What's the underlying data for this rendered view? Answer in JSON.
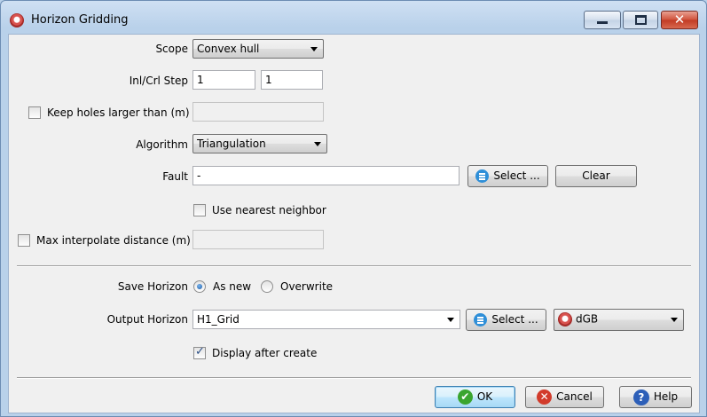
{
  "window": {
    "title": "Horizon Gridding",
    "minimize_glyph": "",
    "maximize_glyph": "",
    "close_glyph": "✕"
  },
  "scope": {
    "label": "Scope",
    "value": "Convex hull"
  },
  "step": {
    "label": "Inl/Crl Step",
    "inline": "1",
    "crossline": "1"
  },
  "keep_holes": {
    "label": "Keep holes larger than (m)",
    "checked": false,
    "value": ""
  },
  "algorithm": {
    "label": "Algorithm",
    "value": "Triangulation"
  },
  "fault": {
    "label": "Fault",
    "value": "-",
    "select_label": "Select ...",
    "clear_label": "Clear"
  },
  "nearest_neighbor": {
    "label": "Use nearest neighbor",
    "checked": false
  },
  "max_interp": {
    "label": "Max interpolate distance (m)",
    "checked": false,
    "value": ""
  },
  "save_horizon": {
    "label": "Save Horizon",
    "options": [
      "As new",
      "Overwrite"
    ],
    "selected": "As new"
  },
  "output_horizon": {
    "label": "Output Horizon",
    "value": "H1_Grid",
    "select_label": "Select ...",
    "store": "dGB"
  },
  "display_after": {
    "label": "Display after create",
    "checked": true
  },
  "footer": {
    "ok_label": "OK",
    "cancel_label": "Cancel",
    "help_label": "Help"
  },
  "icons": {
    "app": "horizon-app-icon",
    "select": "list-icon",
    "ok": "check-icon",
    "cancel": "x-icon",
    "help": "help-icon",
    "store": "dgb-logo-icon"
  }
}
